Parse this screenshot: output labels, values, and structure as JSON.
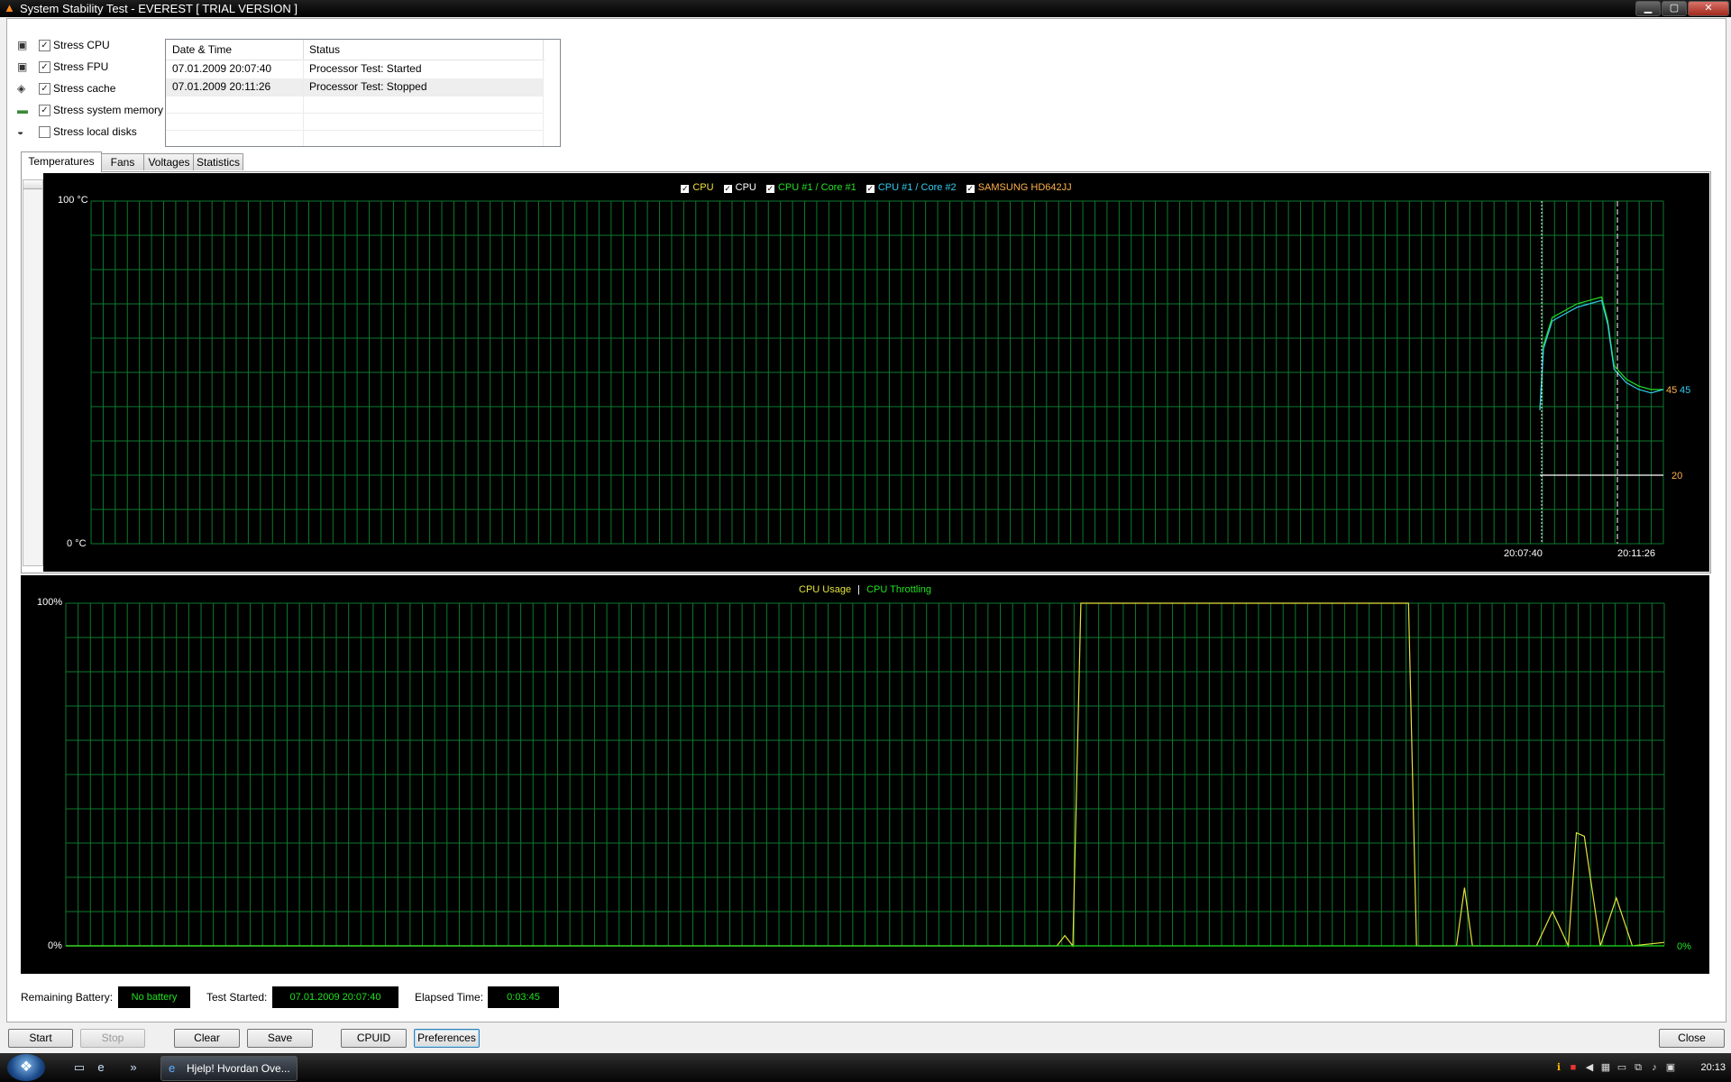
{
  "window": {
    "title": "System Stability Test - EVEREST  [ TRIAL VERSION ]"
  },
  "stress": [
    {
      "label": "Stress CPU",
      "checked": true,
      "icon": "cpu-chip-icon"
    },
    {
      "label": "Stress FPU",
      "checked": true,
      "icon": "fpu-chip-icon"
    },
    {
      "label": "Stress cache",
      "checked": true,
      "icon": "cache-chip-icon"
    },
    {
      "label": "Stress system memory",
      "checked": true,
      "icon": "memory-module-icon"
    },
    {
      "label": "Stress local disks",
      "checked": false,
      "icon": "hard-disk-icon"
    }
  ],
  "log": {
    "columns": [
      "Date & Time",
      "Status"
    ],
    "rows": [
      [
        "07.01.2009 20:07:40",
        "Processor Test: Started"
      ],
      [
        "07.01.2009 20:11:26",
        "Processor Test: Stopped"
      ]
    ]
  },
  "tabs": [
    "Temperatures",
    "Fans",
    "Voltages",
    "Statistics"
  ],
  "temp_chart": {
    "legend": [
      {
        "label": "CPU",
        "color": "#f3e13a"
      },
      {
        "label": "CPU",
        "color": "#ffffff"
      },
      {
        "label": "CPU #1 / Core #1",
        "color": "#22e222"
      },
      {
        "label": "CPU #1 / Core #2",
        "color": "#33ccee"
      },
      {
        "label": "SAMSUNG HD642JJ",
        "color": "#ffb04a"
      }
    ],
    "y_max_label": "100 °C",
    "y_min_label": "0 °C",
    "x_labels": [
      "20:07:40",
      "20:11:26"
    ],
    "value_labels": [
      {
        "text": "45",
        "color": "#ffb04a"
      },
      {
        "text": "45",
        "color": "#33ccee"
      },
      {
        "text": "20",
        "color": "#ffb04a"
      }
    ]
  },
  "usage_chart": {
    "legend_usage": "CPU Usage",
    "legend_sep": "|",
    "legend_throttle": "CPU Throttling",
    "y_max_label": "100%",
    "y_min_label": "0%",
    "value_label": "0%",
    "usage_color": "#e3e33c",
    "throttle_color": "#1ee31e"
  },
  "chart_data": [
    {
      "type": "line",
      "ylabel": "°C",
      "ylim": [
        0,
        100
      ],
      "markers": [
        "20:07:40",
        "20:11:26"
      ],
      "series": [
        {
          "name": "CPU #1 / Core #1",
          "x": [
            0,
            0.03,
            0.1,
            0.2,
            0.3,
            0.4,
            0.5,
            0.55,
            0.6,
            0.7,
            0.8,
            0.9,
            1.0
          ],
          "values": [
            39,
            58,
            66,
            68,
            70,
            71,
            72,
            65,
            52,
            48,
            46,
            45,
            45
          ]
        },
        {
          "name": "CPU #1 / Core #2",
          "x": [
            0,
            0.03,
            0.1,
            0.2,
            0.3,
            0.4,
            0.5,
            0.55,
            0.6,
            0.7,
            0.8,
            0.9,
            1.0
          ],
          "values": [
            39,
            57,
            65,
            67,
            69,
            70,
            71,
            64,
            51,
            47,
            45,
            44,
            45
          ]
        },
        {
          "name": "SAMSUNG HD642JJ",
          "x": [
            0,
            1.0
          ],
          "values": [
            20,
            20
          ]
        }
      ]
    },
    {
      "type": "line",
      "ylabel": "%",
      "ylim": [
        0,
        100
      ],
      "series": [
        {
          "name": "CPU Usage",
          "x": [
            0,
            0.62,
            0.625,
            0.63,
            0.635,
            0.84,
            0.845,
            0.85,
            0.87,
            0.875,
            0.88,
            0.92,
            0.93,
            0.94,
            0.945,
            0.95,
            0.96,
            0.97,
            0.98,
            1.0
          ],
          "values": [
            0,
            0,
            3,
            0,
            100,
            100,
            0,
            0,
            0,
            17,
            0,
            0,
            10,
            0,
            33,
            32,
            0,
            14,
            0,
            1
          ]
        },
        {
          "name": "CPU Throttling",
          "x": [
            0,
            1.0
          ],
          "values": [
            0,
            0
          ]
        }
      ]
    }
  ],
  "status": {
    "battery_label": "Remaining Battery:",
    "battery_value": "No battery",
    "started_label": "Test Started:",
    "started_value": "07.01.2009 20:07:40",
    "elapsed_label": "Elapsed Time:",
    "elapsed_value": "0:03:45"
  },
  "buttons": {
    "start": "Start",
    "stop": "Stop",
    "clear": "Clear",
    "save": "Save",
    "cpuid": "CPUID",
    "preferences": "Preferences",
    "close": "Close"
  },
  "taskbar": {
    "task_label": "Hjelp! Hvordan Ove...",
    "clock": "20:13"
  }
}
